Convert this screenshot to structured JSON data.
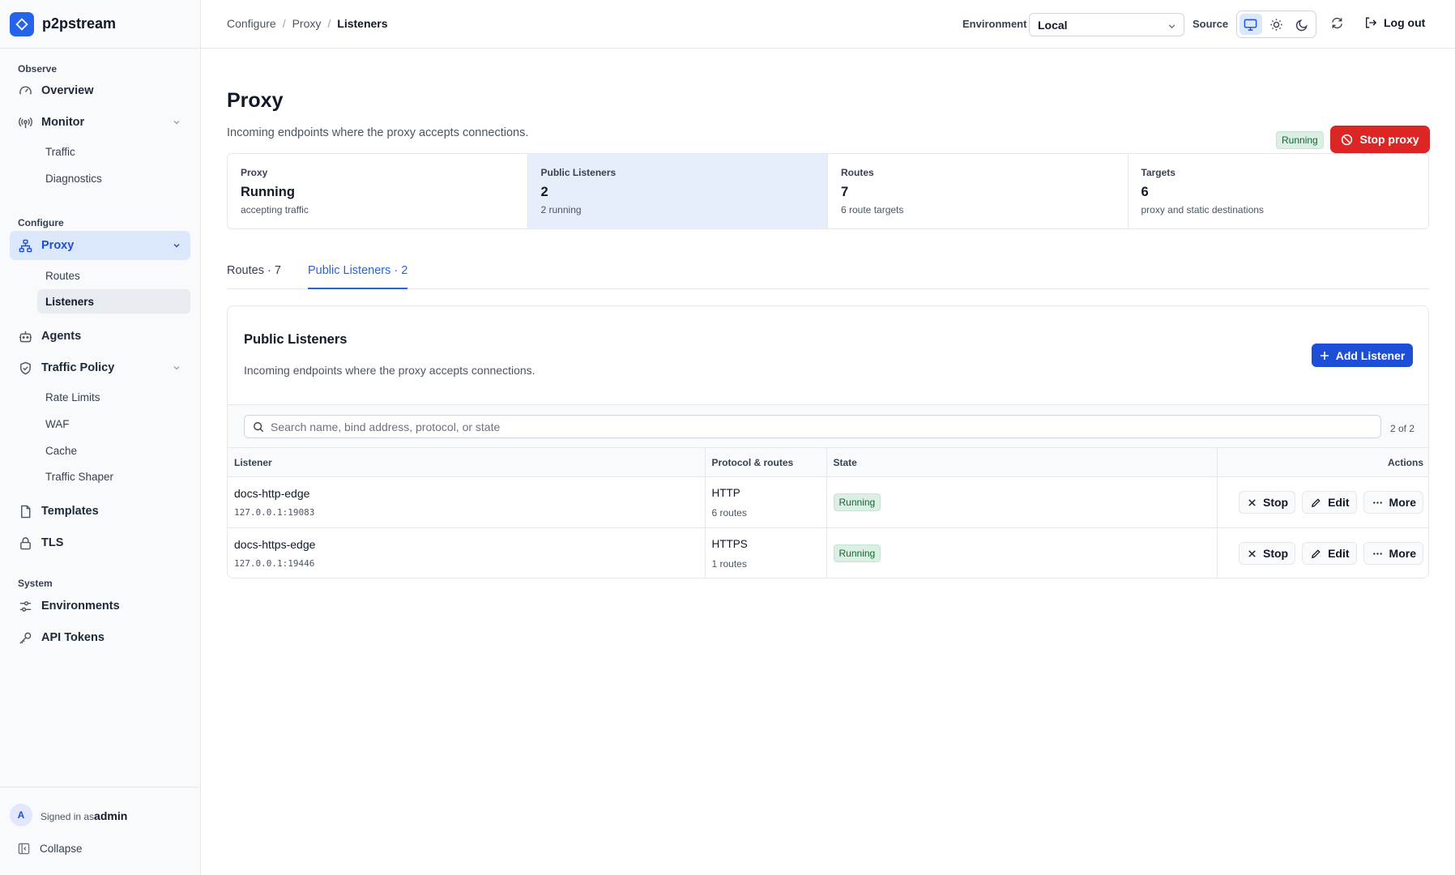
{
  "app": {
    "name": "p2pstream"
  },
  "sidebar": {
    "sections": {
      "observe": "Observe",
      "configure": "Configure",
      "system": "System"
    },
    "items": {
      "overview": "Overview",
      "monitor": "Monitor",
      "traffic": "Traffic",
      "diagnostics": "Diagnostics",
      "proxy": "Proxy",
      "routes": "Routes",
      "listeners": "Listeners",
      "agents": "Agents",
      "traffic_policy": "Traffic Policy",
      "rate_limits": "Rate Limits",
      "waf": "WAF",
      "cache": "Cache",
      "traffic_shaper": "Traffic Shaper",
      "templates": "Templates",
      "tls": "TLS",
      "environments": "Environments",
      "api_tokens": "API Tokens"
    },
    "footer": {
      "avatar_initial": "A",
      "signed_in_prefix": "Signed in as",
      "username": "admin",
      "collapse": "Collapse"
    }
  },
  "topbar": {
    "breadcrumb": [
      "Configure",
      "Proxy",
      "Listeners"
    ],
    "environment_label": "Environment",
    "environment_value": "Local",
    "source_label": "Source",
    "log_out": "Log out"
  },
  "page": {
    "title": "Proxy",
    "subtitle": "Incoming endpoints where the proxy accepts connections.",
    "status_badge": "Running",
    "stop_button": "Stop proxy"
  },
  "stats": [
    {
      "label": "Proxy",
      "value": "Running",
      "sub": "accepting traffic"
    },
    {
      "label": "Public Listeners",
      "value": "2",
      "sub": "2 running"
    },
    {
      "label": "Routes",
      "value": "7",
      "sub": "6 route targets"
    },
    {
      "label": "Targets",
      "value": "6",
      "sub": "proxy and static destinations"
    }
  ],
  "tabs": [
    {
      "label": "Routes · 7"
    },
    {
      "label": "Public Listeners · 2"
    }
  ],
  "listeners_card": {
    "title": "Public Listeners",
    "subtitle": "Incoming endpoints where the proxy accepts connections.",
    "add_button": "Add Listener",
    "search_placeholder": "Search name, bind address, protocol, or state",
    "count": "2 of 2",
    "columns": [
      "Listener",
      "Protocol & routes",
      "State",
      "Actions"
    ],
    "rows": [
      {
        "name": "docs-http-edge",
        "address": "127.0.0.1:19083",
        "protocol": "HTTP",
        "routes": "6 routes",
        "state": "Running"
      },
      {
        "name": "docs-https-edge",
        "address": "127.0.0.1:19446",
        "protocol": "HTTPS",
        "routes": "1 routes",
        "state": "Running"
      }
    ],
    "actions": {
      "stop": "Stop",
      "edit": "Edit",
      "more": "More"
    }
  },
  "colors": {
    "accent": "#2563eb",
    "danger": "#dc2626",
    "success_bg": "#dcefe4",
    "success_text": "#166534"
  }
}
